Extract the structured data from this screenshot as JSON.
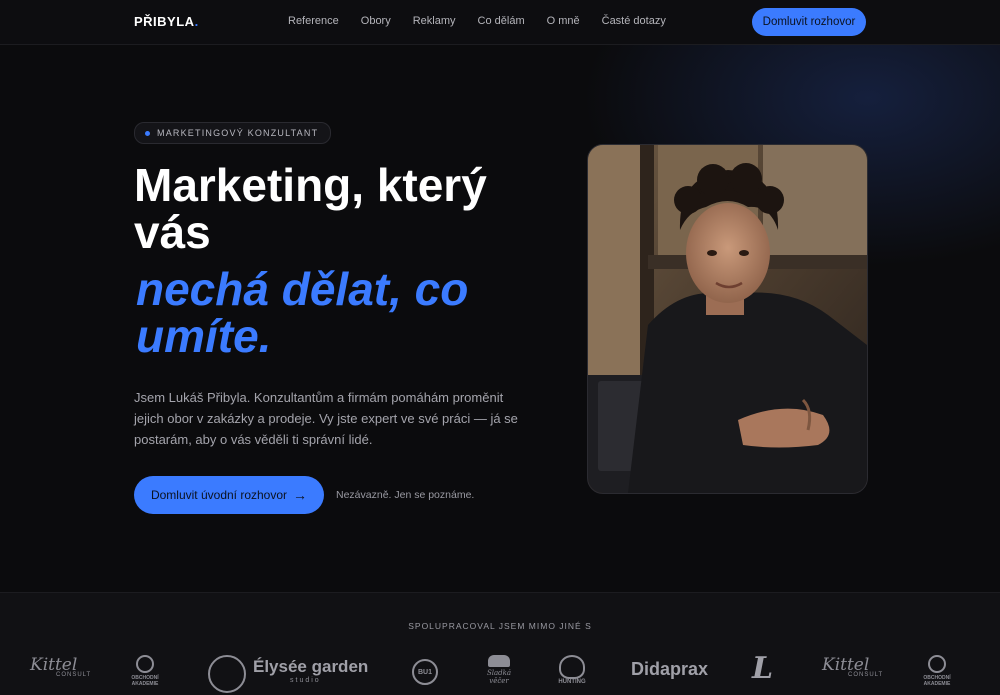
{
  "header": {
    "logo_text": "PŘIBYLA",
    "logo_dot": ".",
    "nav": [
      {
        "label": "Reference"
      },
      {
        "label": "Obory"
      },
      {
        "label": "Reklamy"
      },
      {
        "label": "Co dělám"
      },
      {
        "label": "O mně"
      },
      {
        "label": "Časté dotazy"
      }
    ],
    "cta_label": "Domluvit rozhovor"
  },
  "hero": {
    "badge": "MARKETINGOVÝ KONZULTANT",
    "title_line1": "Marketing, který",
    "title_line2": "vás",
    "accent_line1": "nechá dělat, co",
    "accent_line2": "umíte.",
    "lead": "Jsem Lukáš Přibyla. Konzultantům a firmám pomáhám proměnit jejich obor v zakázky a prodeje. Vy jste expert ve své práci — já se postarám, aby o vás věděli ti správní lidé.",
    "cta_label": "Domluvit úvodní rozhovor",
    "cta_arrow": "→",
    "cta_note": "Nezávazně. Jen se poznáme."
  },
  "partners": {
    "title": "SPOLUPRACOVAL JSEM MIMO JINÉ S",
    "logos": [
      {
        "name": "Kittel",
        "sub": "CONSULT"
      },
      {
        "name": "OBCHODNÍ AKADEMIE"
      },
      {
        "name": "Élysée garden",
        "sub": "studio"
      },
      {
        "name": "BU1"
      },
      {
        "name": "Sladká věčer"
      },
      {
        "name": "HUNTING"
      },
      {
        "name": "Didaprax"
      },
      {
        "name": "L"
      },
      {
        "name": "Kittel",
        "sub": "CONSULT"
      },
      {
        "name": "OBCHODNÍ AKADEMIE"
      }
    ]
  },
  "colors": {
    "accent": "#3b7bff",
    "background": "#0b0b0d"
  }
}
